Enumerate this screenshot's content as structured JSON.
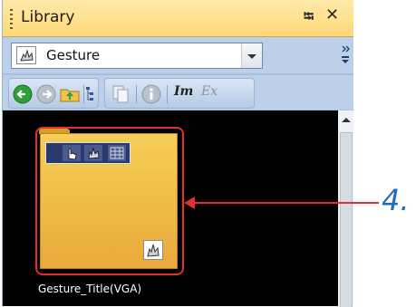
{
  "panel": {
    "title": "Library",
    "pin_icon": "pin-icon",
    "close_icon": "close-icon"
  },
  "library_select": {
    "value": "Gesture",
    "icon": "gesture-hand-icon"
  },
  "toolbar": {
    "buttons": [
      "back-icon",
      "forward-icon",
      "folder-up-icon",
      "tree-view-icon",
      "copy-icon",
      "info-icon",
      "import-icon",
      "export-icon"
    ],
    "import_label": "Im",
    "export_label": "Ex"
  },
  "item": {
    "label": "Gesture_Title(VGA)",
    "strip_icons": [
      "tap-hand-icon",
      "swipe-hand-icon",
      "grid-icon"
    ],
    "type_icon": "gesture-hand-icon"
  },
  "annotation": {
    "callout": "4."
  },
  "colors": {
    "highlight": "#e0312d",
    "callout": "#1f6fb5",
    "card": "#f0be48",
    "titlebar": "#ffd978"
  }
}
